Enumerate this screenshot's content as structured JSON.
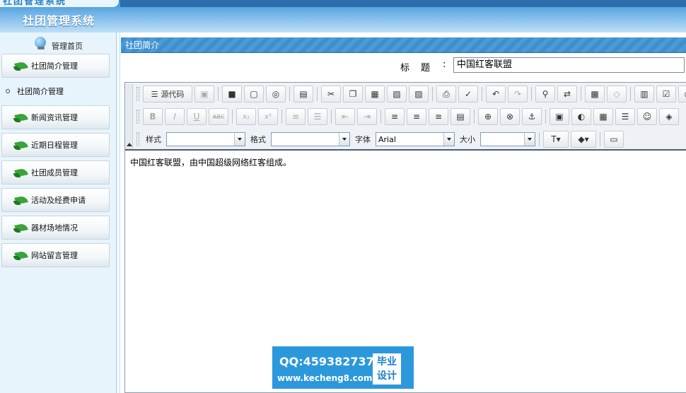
{
  "banner": {
    "logo_text": "社团管理系统",
    "title": "社团管理系统"
  },
  "sidebar": {
    "home_label": "管理首页",
    "items": [
      {
        "label": "社团简介管理"
      },
      {
        "label": "新闻资讯管理"
      },
      {
        "label": "近期日程管理"
      },
      {
        "label": "社团成员管理"
      },
      {
        "label": "活动及经费申请"
      },
      {
        "label": "器材场地情况"
      },
      {
        "label": "网站留言管理"
      }
    ],
    "submenu": {
      "label": "社团简介管理"
    }
  },
  "content": {
    "header": "社团简介",
    "title_label": "标题",
    "title_colon": ":",
    "title_value": "中国红客联盟"
  },
  "editor": {
    "source_label": "源代码",
    "row3": {
      "style_label": "样式",
      "format_label": "格式",
      "font_label": "字体",
      "font_value": "Arial",
      "size_label": "大小"
    },
    "body_text": "中国红客联盟，由中国超级网络红客组成。"
  },
  "watermark": {
    "qq": "QQ:459382737",
    "url": "www.kecheng8.com",
    "badge_line1": "毕业",
    "badge_line2": "设计"
  }
}
